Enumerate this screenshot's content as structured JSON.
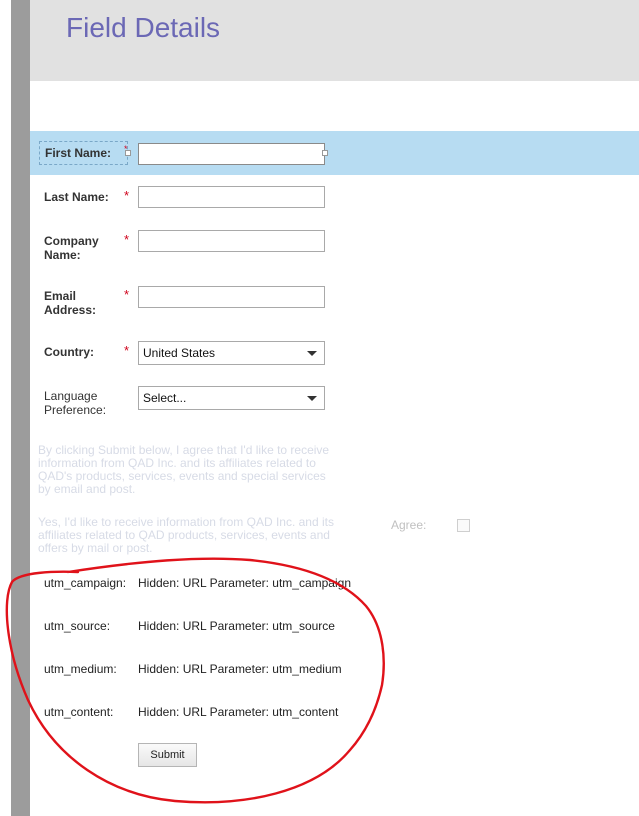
{
  "header": {
    "title": "Field Details"
  },
  "form": {
    "first_name": {
      "label": "First Name:",
      "required": "*",
      "value": ""
    },
    "last_name": {
      "label": "Last Name:",
      "required": "*",
      "value": ""
    },
    "company": {
      "label_1": "Company",
      "label_2": "Name:",
      "required": "*",
      "value": ""
    },
    "email": {
      "label_1": "Email",
      "label_2": "Address:",
      "required": "*",
      "value": ""
    },
    "country": {
      "label": "Country:",
      "required": "*",
      "selected": "United States"
    },
    "language": {
      "label_1": "Language",
      "label_2": "Preference:",
      "selected": "Select..."
    },
    "consent_1": {
      "lines": [
        "By clicking Submit below, I agree that I'd like to receive",
        "information from QAD Inc. and its affiliates related to",
        "QAD's products, services, events and special services",
        "by email and post."
      ]
    },
    "consent_2": {
      "lines": [
        "Yes, I'd like to receive information from QAD Inc. and its",
        "affiliates related to QAD products, services, events and",
        "offers by mail or post."
      ]
    },
    "agree": {
      "label": "Agree:",
      "checked": false
    },
    "hidden_fields": [
      {
        "label": "utm_campaign:",
        "value": "Hidden: URL Parameter: utm_campaign"
      },
      {
        "label": "utm_source:",
        "value": "Hidden: URL Parameter: utm_source"
      },
      {
        "label": "utm_medium:",
        "value": "Hidden: URL Parameter: utm_medium"
      },
      {
        "label": "utm_content:",
        "value": "Hidden: URL Parameter: utm_content"
      }
    ],
    "submit_label": "Submit"
  },
  "colors": {
    "title": "#6b68b5",
    "highlight": "#b7dcf2",
    "required": "#d0021b",
    "annotation": "#e0121a"
  },
  "icons": [
    "chevron-down-icon",
    "resize-handle-icon"
  ]
}
